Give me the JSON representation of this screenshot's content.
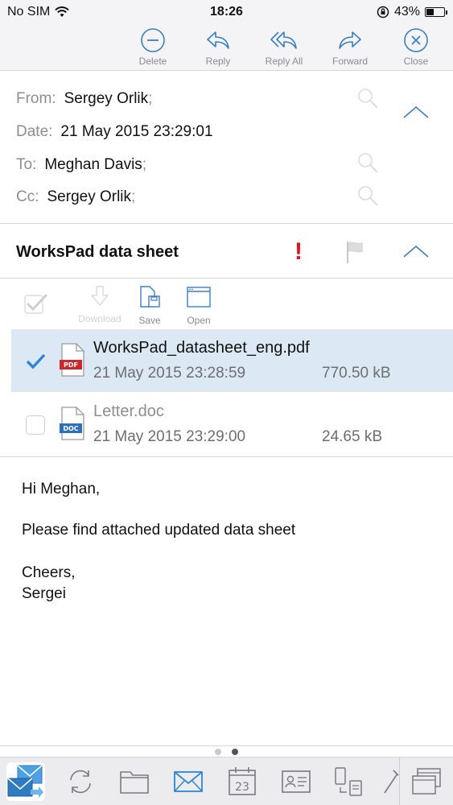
{
  "status_bar": {
    "carrier": "No SIM",
    "time": "18:26",
    "battery_percent": "43%",
    "battery_level": 0.43
  },
  "toolbar": {
    "delete_label": "Delete",
    "reply_label": "Reply",
    "reply_all_label": "Reply All",
    "forward_label": "Forward",
    "close_label": "Close"
  },
  "header": {
    "from_label": "From:",
    "from_value": "Sergey Orlik",
    "date_label": "Date:",
    "date_value": "21 May 2015 23:29:01",
    "to_label": "To:",
    "to_value": "Meghan Davis",
    "cc_label": "Cc:",
    "cc_value": "Sergey Orlik",
    "separator": ";"
  },
  "subject": {
    "title": "WorksPad data sheet",
    "importance": "!"
  },
  "attachment_toolbar": {
    "download_label": "Download",
    "save_label": "Save",
    "open_label": "Open"
  },
  "attachments": [
    {
      "name": "WorksPad_datasheet_eng.pdf",
      "date": "21 May 2015 23:28:59",
      "size": "770.50 kB",
      "type_badge": "PDF",
      "selected": true
    },
    {
      "name": "Letter.doc",
      "date": "21 May 2015 23:29:00",
      "size": "24.65 kB",
      "type_badge": "DOC",
      "selected": false
    }
  ],
  "body": {
    "greeting": "Hi Meghan,",
    "line1": "Please find attached updated data sheet",
    "closing": "Cheers,",
    "signature": "Sergei"
  },
  "dock": {
    "calendar_day": "23"
  },
  "colors": {
    "accent": "#3a7fc4",
    "selected_row": "#dce9f5",
    "importance": "#e0161e",
    "pdf_badge": "#c9282d",
    "doc_badge": "#2f6fb5"
  }
}
